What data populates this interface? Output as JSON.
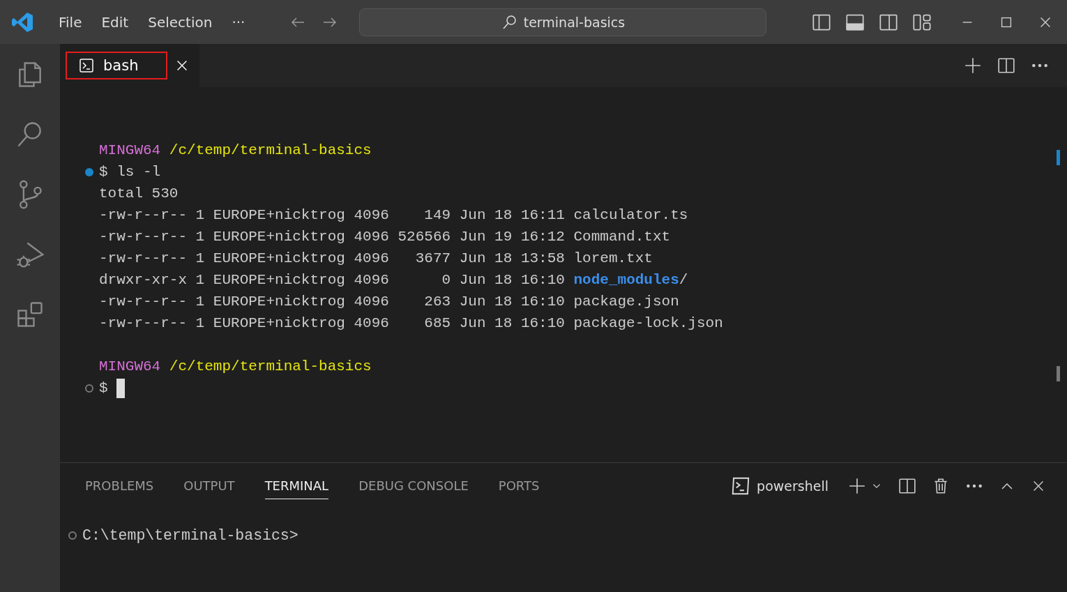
{
  "title_bar": {
    "menu": [
      "File",
      "Edit",
      "Selection",
      "···"
    ],
    "search": "terminal-basics"
  },
  "activity_bar": {
    "items": [
      {
        "kind": "files",
        "selected": false
      },
      {
        "kind": "search",
        "selected": false
      },
      {
        "kind": "branch",
        "selected": false
      },
      {
        "kind": "debug",
        "selected": false
      },
      {
        "kind": "extensions",
        "selected": false
      }
    ]
  },
  "editor_tabs": [
    {
      "label": "bash",
      "selected": true,
      "highlighted": true
    }
  ],
  "terminal": {
    "lines": [
      {
        "kind": "prompt",
        "host": "MINGW64",
        "path": "/c/temp/terminal-basics"
      },
      {
        "kind": "command",
        "succeeded": true,
        "text": "$ ls -l",
        "cursor": false
      },
      {
        "kind": "output",
        "segments": [
          {
            "text": "total 530"
          }
        ]
      },
      {
        "kind": "output",
        "segments": [
          {
            "text": "-rw-r--r-- 1 EUROPE+nicktrog 4096    149 Jun 18 16:11 calculator.ts"
          }
        ]
      },
      {
        "kind": "output",
        "segments": [
          {
            "text": "-rw-r--r-- 1 EUROPE+nicktrog 4096 526566 Jun 19 16:12 Command.txt"
          }
        ]
      },
      {
        "kind": "output",
        "segments": [
          {
            "text": "-rw-r--r-- 1 EUROPE+nicktrog 4096   3677 Jun 18 13:58 lorem.txt"
          }
        ]
      },
      {
        "kind": "output",
        "segments": [
          {
            "text": "drwxr-xr-x 1 EUROPE+nicktrog 4096      0 Jun 18 16:10 "
          },
          {
            "text": "node_modules",
            "kind": "dir"
          },
          {
            "text": "/"
          }
        ]
      },
      {
        "kind": "output",
        "segments": [
          {
            "text": "-rw-r--r-- 1 EUROPE+nicktrog 4096    263 Jun 18 16:10 package.json"
          }
        ]
      },
      {
        "kind": "output",
        "segments": [
          {
            "text": "-rw-r--r-- 1 EUROPE+nicktrog 4096    685 Jun 18 16:10 package-lock.json"
          }
        ]
      },
      {
        "kind": "blank"
      },
      {
        "kind": "prompt",
        "host": "MINGW64",
        "path": "/c/temp/terminal-basics"
      },
      {
        "kind": "command",
        "succeeded": false,
        "text": "$ ",
        "cursor": true
      }
    ]
  },
  "panel": {
    "tabs": [
      {
        "label": "PROBLEMS",
        "selected": false
      },
      {
        "label": "OUTPUT",
        "selected": false
      },
      {
        "label": "TERMINAL",
        "selected": true
      },
      {
        "label": "DEBUG CONSOLE",
        "selected": false
      },
      {
        "label": "PORTS",
        "selected": false
      }
    ],
    "terminal_name": "powershell",
    "lines": [
      {
        "kind": "command",
        "succeeded": false,
        "text": "C:\\temp\\terminal-basics>",
        "cursor": false
      }
    ]
  }
}
